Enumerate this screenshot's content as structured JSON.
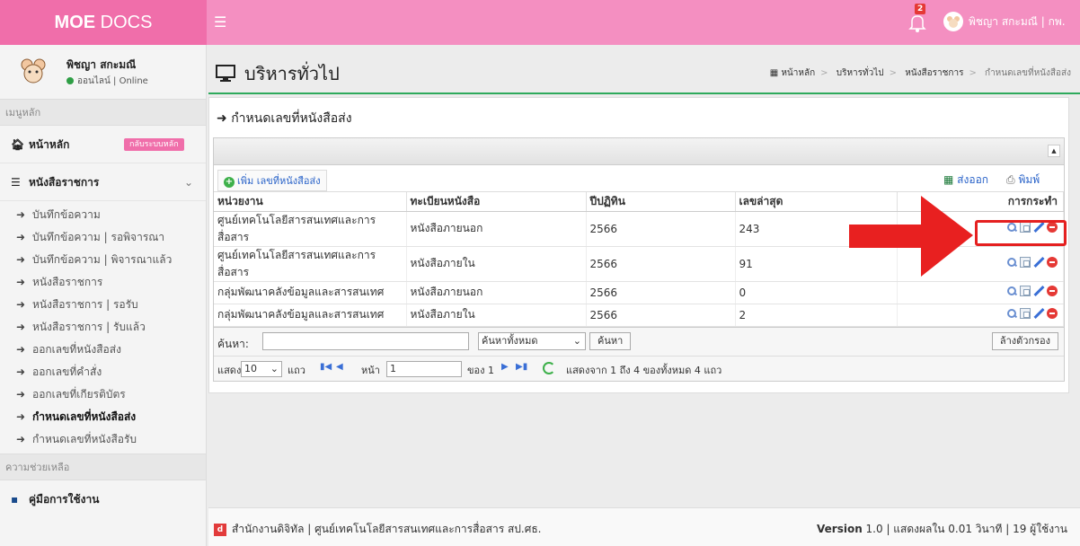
{
  "brand": {
    "bold": "MOE",
    "rest": " DOCS"
  },
  "topbar": {
    "notif_count": "2",
    "user_label": "พิชญา สกะมณี | กพ."
  },
  "sidebar": {
    "user_name": "พิชญา สกะมณี",
    "user_status": "ออนไลน์ | Online",
    "section_main": "เมนูหลัก",
    "home_label": "หน้าหลัก",
    "back_label": "กลับระบบหลัก",
    "docs_label": "หนังสือราชการ",
    "sub_items": [
      "บันทึกข้อความ",
      "บันทึกข้อความ | รอพิจารณา",
      "บันทึกข้อความ | พิจารณาแล้ว",
      "หนังสือราชการ",
      "หนังสือราชการ | รอรับ",
      "หนังสือราชการ | รับแล้ว",
      "ออกเลขที่หนังสือส่ง",
      "ออกเลขที่คำสั่ง",
      "ออกเลขที่เกียรติบัตร",
      "กำหนดเลขที่หนังสือส่ง",
      "กำหนดเลขที่หนังสือรับ"
    ],
    "section_help": "ความช่วยเหลือ",
    "manual_label": "คู่มือการใช้งาน"
  },
  "header": {
    "title": "บริหารทั่วไป",
    "breadcrumb": [
      "หน้าหลัก",
      "บริหารทั่วไป",
      "หนังสือราชการ",
      "กำหนดเลขที่หนังสือส่ง"
    ]
  },
  "box": {
    "title": "กำหนดเลขที่หนังสือส่ง",
    "add_label": "เพิ่ม เลขที่หนังสือส่ง",
    "export_label": "ส่งออก",
    "print_label": "พิมพ์"
  },
  "table": {
    "columns": [
      "หน่วยงาน",
      "ทะเบียนหนังสือ",
      "ปีปฏิทิน",
      "เลขล่าสุด",
      "การกระทำ"
    ],
    "rows": [
      [
        "ศูนย์เทคโนโลยีสารสนเทศและการสื่อสาร",
        "หนังสือภายนอก",
        "2566",
        "243"
      ],
      [
        "ศูนย์เทคโนโลยีสารสนเทศและการสื่อสาร",
        "หนังสือภายใน",
        "2566",
        "91"
      ],
      [
        "กลุ่มพัฒนาคลังข้อมูลและสารสนเทศ",
        "หนังสือภายนอก",
        "2566",
        "0"
      ],
      [
        "กลุ่มพัฒนาคลังข้อมูลและสารสนเทศ",
        "หนังสือภายใน",
        "2566",
        "2"
      ]
    ]
  },
  "search": {
    "label": "ค้นหา:",
    "value": "",
    "scope": "ค้นหาทั้งหมด",
    "button": "ค้นหา",
    "clear": "ล้างตัวกรอง"
  },
  "pager": {
    "show": "แสดง",
    "page_size": "10",
    "rows_word": "แถว",
    "page_word": "หน้า",
    "page": "1",
    "of_word": "ของ 1",
    "summary": "แสดงจาก 1 ถึง 4 ของทั้งหมด 4 แถว"
  },
  "footer": {
    "left": "สำนักงานดิจิทัล | ศูนย์เทคโนโลยีสารสนเทศและการสื่อสาร สป.ศธ.",
    "version_label": "Version",
    "right": " 1.0 | แสดงผลใน 0.01 วินาที | 19 ผู้ใช้งาน"
  },
  "colors": {
    "brand": "#f06eaa",
    "topbar": "#f48fc1",
    "accent": "#2eaa5c",
    "callout": "#e52020"
  }
}
